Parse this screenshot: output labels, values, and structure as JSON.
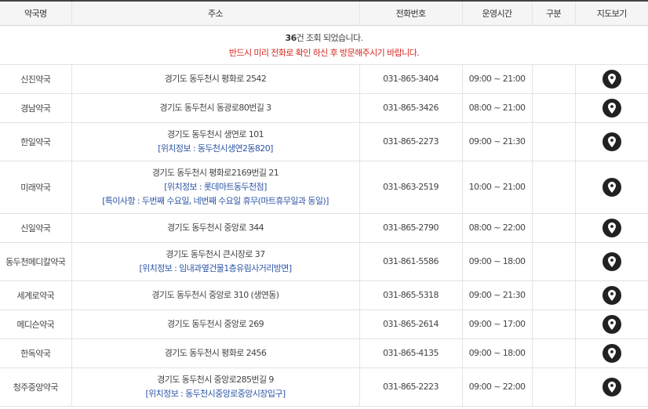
{
  "headers": {
    "name": "약국명",
    "address": "주소",
    "phone": "전화번호",
    "hours": "운영시간",
    "category": "구분",
    "map": "지도보기"
  },
  "summary": {
    "count": "36",
    "count_suffix": "건 조회 되었습니다.",
    "notice": "반드시 미리 전화로 확인 하신 후 방문해주시기 바랍니다."
  },
  "icons": {
    "map": "map-marker-icon"
  },
  "rows": [
    {
      "name": "신진약국",
      "address": "경기도 동두천시 평화로 2542",
      "extras": [],
      "phone": "031-865-3404",
      "hours": "09:00 ~ 21:00",
      "category": ""
    },
    {
      "name": "경남약국",
      "address": "경기도 동두천시 동광로80번길 3",
      "extras": [],
      "phone": "031-865-3426",
      "hours": "08:00 ~ 21:00",
      "category": ""
    },
    {
      "name": "한일약국",
      "address": "경기도 동두천시 생연로 101",
      "extras": [
        "[위치정보 : 동두천시생연2동820]"
      ],
      "phone": "031-865-2273",
      "hours": "09:00 ~ 21:30",
      "category": ""
    },
    {
      "name": "미래약국",
      "address": "경기도 동두천시 평화로2169번길 21",
      "extras": [
        "[위치정보 : 롯데마트동두천점]",
        "[특이사항 : 두번째 수요일, 네번째 수요일 휴무(마트휴무일과 동일)]"
      ],
      "phone": "031-863-2519",
      "hours": "10:00 ~ 21:00",
      "category": ""
    },
    {
      "name": "신일약국",
      "address": "경기도 동두천시 중앙로 344",
      "extras": [],
      "phone": "031-865-2790",
      "hours": "08:00 ~ 22:00",
      "category": ""
    },
    {
      "name": "동두천메디칼약국",
      "address": "경기도 동두천시 큰시장로 37",
      "extras": [
        "[위치정보 : 임내과옆건물1층유림사거리방면]"
      ],
      "phone": "031-861-5586",
      "hours": "09:00 ~ 18:00",
      "category": ""
    },
    {
      "name": "세계로약국",
      "address": "경기도 동두천시 중앙로 310 (생연동)",
      "extras": [],
      "phone": "031-865-5318",
      "hours": "09:00 ~ 21:30",
      "category": ""
    },
    {
      "name": "메디슨약국",
      "address": "경기도 동두천시 중앙로 269",
      "extras": [],
      "phone": "031-865-2614",
      "hours": "09:00 ~ 17:00",
      "category": ""
    },
    {
      "name": "한독약국",
      "address": "경기도 동두천시 평화로 2456",
      "extras": [],
      "phone": "031-865-4135",
      "hours": "09:00 ~ 18:00",
      "category": ""
    },
    {
      "name": "청주중앙약국",
      "address": "경기도 동두천시 중앙로285번길 9",
      "extras": [
        "[위치정보 : 동두천시중앙로중앙시장입구]"
      ],
      "phone": "031-865-2223",
      "hours": "09:00 ~ 22:00",
      "category": ""
    }
  ]
}
